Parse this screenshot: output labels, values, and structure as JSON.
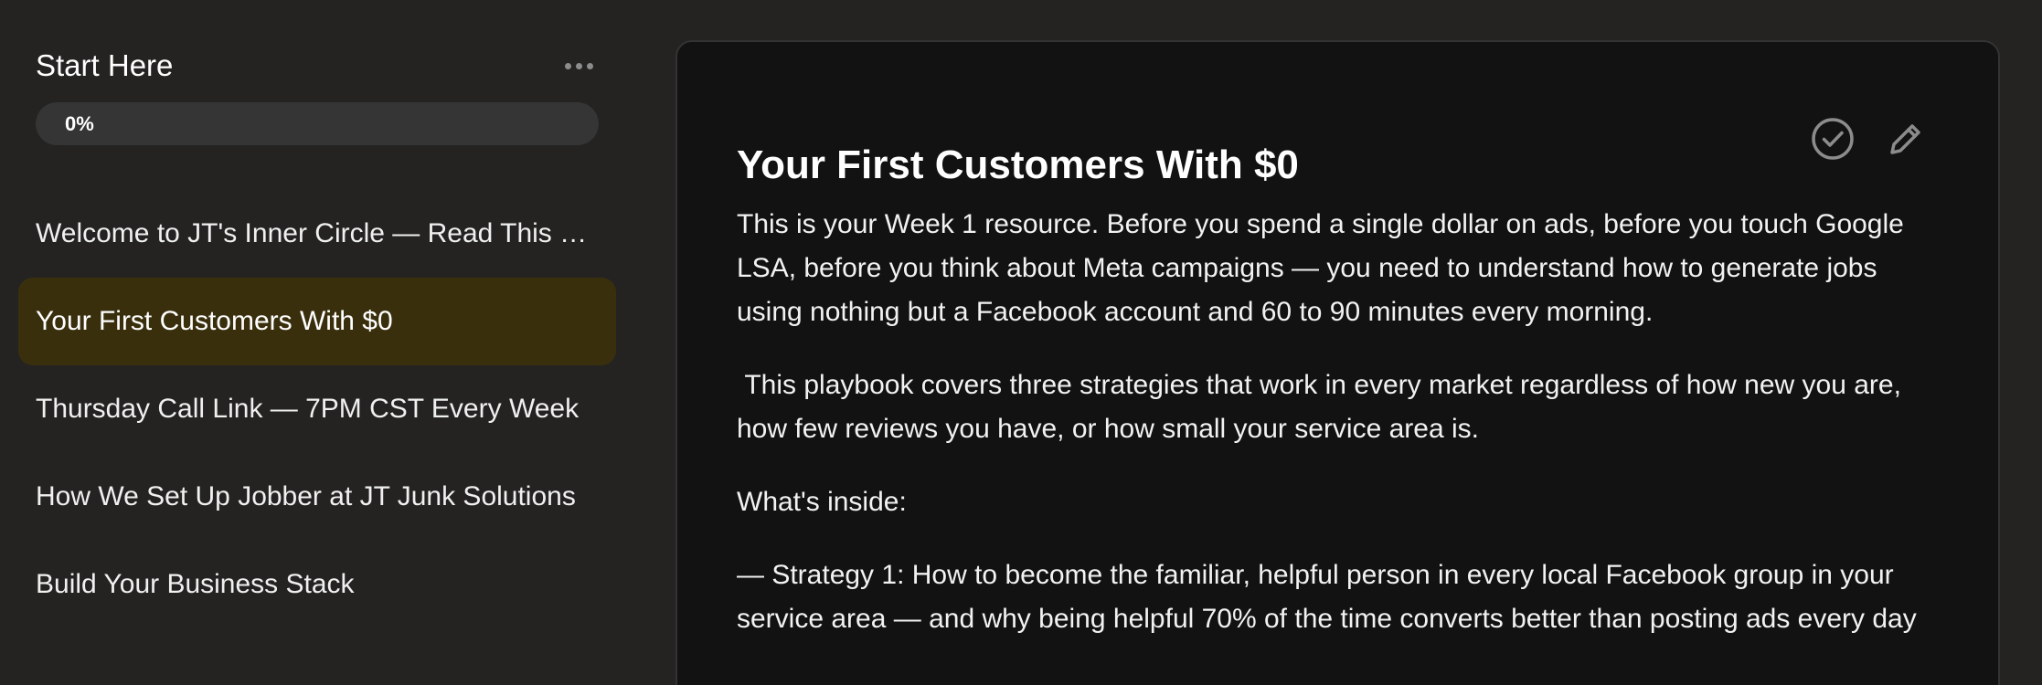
{
  "sidebar": {
    "title": "Start Here",
    "more_icon": "more-horizontal-icon",
    "progress": {
      "percent": 0,
      "label": "0%"
    },
    "items": [
      {
        "label": "Welcome to JT's Inner Circle — Read This First",
        "active": false
      },
      {
        "label": "Your First Customers With $0",
        "active": true
      },
      {
        "label": "Thursday Call Link — 7PM CST Every Week",
        "active": false
      },
      {
        "label": "How We Set Up Jobber at JT Junk Solutions",
        "active": false
      },
      {
        "label": "Build Your Business Stack",
        "active": false
      }
    ]
  },
  "content": {
    "title": "Your First Customers With $0",
    "complete_icon": "check-circle-icon",
    "edit_icon": "pencil-icon",
    "paragraphs": [
      "This is your Week 1 resource. Before you spend a single dollar on ads, before you touch Google LSA, before you think about Meta campaigns — you need to understand how to generate jobs using nothing but a Facebook account and 60 to 90 minutes every morning.",
      " This playbook covers three strategies that work in every market regardless of how new you are, how few reviews you have, or how small your service area is.",
      "What's inside:",
      "— Strategy 1: How to become the familiar, helpful person in every local Facebook group in your service area — and why being helpful 70% of the time converts better than posting ads every day"
    ]
  },
  "colors": {
    "background": "#242322",
    "card": "#121212",
    "active_item": "#3a2f0d",
    "progress_track": "#353535",
    "icon": "#8c8c8c"
  }
}
